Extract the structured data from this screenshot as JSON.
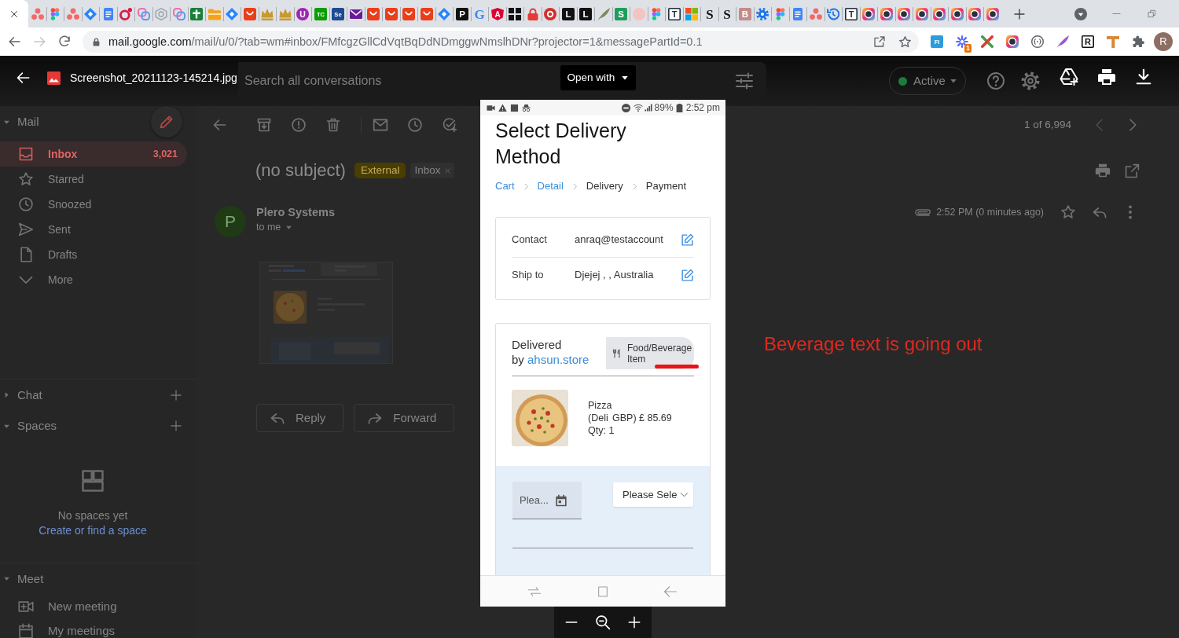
{
  "browser": {
    "tabs": [
      {
        "selected": true
      },
      {
        "selected": false,
        "kind": "dots",
        "color": "#f06a6a"
      },
      {
        "selected": false,
        "kind": "blocks"
      },
      {
        "selected": false,
        "kind": "dots",
        "color": "#f06a6a"
      },
      {
        "selected": false,
        "kind": "diamond",
        "color": "#2684ff"
      },
      {
        "selected": false,
        "kind": "doc",
        "color": "#4285f4"
      },
      {
        "selected": false,
        "kind": "ring",
        "color": "#d81b47"
      },
      {
        "selected": false,
        "kind": "knot",
        "color": "#ec6fb0"
      },
      {
        "selected": false,
        "kind": "hexagon",
        "color": "#9aa0a6"
      },
      {
        "selected": false,
        "kind": "knot",
        "color": "#ec6fb0"
      },
      {
        "selected": false,
        "kind": "cross",
        "color": "#188038"
      },
      {
        "selected": false,
        "kind": "folder",
        "color": "#f4a31b"
      },
      {
        "selected": false,
        "kind": "diamond",
        "color": "#2684ff"
      },
      {
        "selected": false,
        "kind": "cup",
        "color": "#ea3e1a"
      },
      {
        "selected": false,
        "kind": "crown",
        "color": "#c79a2e"
      },
      {
        "selected": false,
        "kind": "crown",
        "color": "#c79a2e"
      },
      {
        "selected": false,
        "kind": "badge",
        "color": "#9c27b0",
        "glyph": "U"
      },
      {
        "selected": false,
        "kind": "tile",
        "color": "#0a9e01",
        "glyph": "TC"
      },
      {
        "selected": false,
        "kind": "tile",
        "color": "#1d4a93",
        "glyph": "Se"
      },
      {
        "selected": false,
        "kind": "mail",
        "color": "#6a1b9a"
      },
      {
        "selected": false,
        "kind": "cup",
        "color": "#ea3e1a"
      },
      {
        "selected": false,
        "kind": "cup",
        "color": "#ea3e1a"
      },
      {
        "selected": false,
        "kind": "cup",
        "color": "#ea3e1a"
      },
      {
        "selected": false,
        "kind": "cup",
        "color": "#ea3e1a"
      },
      {
        "selected": false,
        "kind": "diamond",
        "color": "#2684ff"
      },
      {
        "selected": false,
        "kind": "tile",
        "color": "#111111",
        "glyph": "P"
      },
      {
        "selected": false,
        "kind": "letter",
        "color": "#4285f4",
        "glyph": "G"
      },
      {
        "selected": false,
        "kind": "shield",
        "color": "#dd0031",
        "glyph": "A"
      },
      {
        "selected": false,
        "kind": "grid",
        "color": "#111111"
      },
      {
        "selected": false,
        "kind": "lock",
        "color": "#e53935"
      },
      {
        "selected": false,
        "kind": "target",
        "color": "#d32f2f"
      },
      {
        "selected": false,
        "kind": "tile",
        "color": "#111111",
        "glyph": "L"
      },
      {
        "selected": false,
        "kind": "tile",
        "color": "#111111",
        "glyph": "L"
      },
      {
        "selected": false,
        "kind": "pen",
        "color": "#7b8b5c"
      },
      {
        "selected": false,
        "kind": "tile",
        "color": "#1e9e5a",
        "glyph": "S"
      },
      {
        "selected": false,
        "kind": "faint",
        "color": "#f2c4c4"
      },
      {
        "selected": false,
        "kind": "blocks"
      },
      {
        "selected": false,
        "kind": "frame",
        "color": "#1f2d3d",
        "glyph": "T"
      },
      {
        "selected": false,
        "kind": "windows"
      },
      {
        "selected": false,
        "kind": "letter",
        "color": "#111111",
        "glyph": "S"
      },
      {
        "selected": false,
        "kind": "letter",
        "color": "#111111",
        "glyph": "S"
      },
      {
        "selected": false,
        "kind": "tile",
        "color": "#c48b8b",
        "glyph": "B"
      },
      {
        "selected": false,
        "kind": "gear",
        "color": "#1a73e8"
      },
      {
        "selected": false,
        "kind": "blocks"
      },
      {
        "selected": false,
        "kind": "doc",
        "color": "#4285f4"
      },
      {
        "selected": false,
        "kind": "dots",
        "color": "#f06a6a"
      },
      {
        "selected": false,
        "kind": "clock",
        "color": "#1a73e8"
      },
      {
        "selected": false,
        "kind": "frame",
        "color": "#1f2d3d",
        "glyph": "T"
      },
      {
        "selected": false,
        "kind": "lens"
      },
      {
        "selected": false,
        "kind": "lens"
      },
      {
        "selected": false,
        "kind": "lens"
      },
      {
        "selected": false,
        "kind": "lens"
      },
      {
        "selected": false,
        "kind": "lens"
      },
      {
        "selected": false,
        "kind": "lens"
      },
      {
        "selected": false,
        "kind": "lens"
      },
      {
        "selected": false,
        "kind": "lens"
      }
    ],
    "address": {
      "host": "mail.google.com",
      "path": "/mail/u/0/?tab=wm#inbox/FMfcgzGllCdVqtBqDdNDmggwNmslhDNr?projector=1&messagePartId=0.1"
    },
    "extensions": [
      {
        "kind": "tile",
        "color": "#2d9cdb",
        "glyph": "FI"
      },
      {
        "kind": "burst",
        "color": "#5468ff",
        "badge": "1"
      },
      {
        "kind": "xmark"
      },
      {
        "kind": "lens"
      },
      {
        "kind": "braces",
        "color": "#5f6368"
      },
      {
        "kind": "pen",
        "color": "#9b59d0"
      },
      {
        "kind": "frame",
        "color": "#111111",
        "glyph": "R"
      },
      {
        "kind": "tool",
        "color": "#d9893b"
      },
      {
        "kind": "puzzle",
        "color": "#5f6368"
      }
    ],
    "profile_initial": "R"
  },
  "viewer": {
    "file_name": "Screenshot_20211123-145214.jpg",
    "open_with": "Open with"
  },
  "gmail": {
    "search": {
      "placeholder": "Search all conversations"
    },
    "status": "Active",
    "sidebar": {
      "mail": {
        "heading": "Mail",
        "expanded": true,
        "items": [
          {
            "label": "Inbox",
            "count": "3,021",
            "kind": "inbox",
            "selected": true
          },
          {
            "label": "Starred",
            "kind": "star",
            "selected": false
          },
          {
            "label": "Snoozed",
            "kind": "clock",
            "selected": false
          },
          {
            "label": "Sent",
            "kind": "send",
            "selected": false
          },
          {
            "label": "Drafts",
            "kind": "file",
            "selected": false
          },
          {
            "label": "More",
            "kind": "chevron",
            "selected": false
          }
        ]
      },
      "chat": {
        "heading": "Chat",
        "expanded": false
      },
      "spaces": {
        "heading": "Spaces",
        "expanded": true,
        "empty_text": "No spaces yet",
        "link": "Create or find a space"
      },
      "meet": {
        "heading": "Meet",
        "expanded": true,
        "items": [
          {
            "label": "New meeting",
            "kind": "video"
          },
          {
            "label": "My meetings",
            "kind": "calendar"
          }
        ]
      }
    },
    "message": {
      "position": "1 of 6,994",
      "subject": "(no subject)",
      "labels": [
        {
          "text": "External",
          "kind": "warning"
        },
        {
          "text": "Inbox",
          "kind": "folder"
        }
      ],
      "sender": {
        "initial": "P",
        "name": "Plero Systems",
        "recipient": "to me"
      },
      "time": "2:52 PM (0 minutes ago)",
      "actions": [
        {
          "label": "Reply",
          "kind": "reply"
        },
        {
          "label": "Forward",
          "kind": "forward"
        }
      ]
    }
  },
  "phone": {
    "status_bar": {
      "battery": "89%",
      "time": "2:52 pm"
    },
    "title": "Select Delivery Method",
    "steps": [
      {
        "label": "Cart",
        "done": true
      },
      {
        "label": "Detail",
        "done": true
      },
      {
        "label": "Delivery",
        "done": false
      },
      {
        "label": "Payment",
        "done": false
      }
    ],
    "contact": [
      {
        "label": "Contact",
        "value": "anraq@testaccount"
      },
      {
        "label": "Ship to",
        "value": "Djejej , , Australia"
      }
    ],
    "delivery": {
      "label": "Delivered",
      "by": "by",
      "store": "ahsun.store",
      "category": "Food/Beverage Item",
      "item": {
        "name": "Pizza (Deli",
        "price": "GBP) £ 85.69",
        "quantity": "Qty: 1"
      },
      "date": {
        "placeholder": "Plea..."
      },
      "select": {
        "placeholder": "Please Sele"
      }
    }
  },
  "annotation": {
    "text": "Beverage text is going out"
  }
}
